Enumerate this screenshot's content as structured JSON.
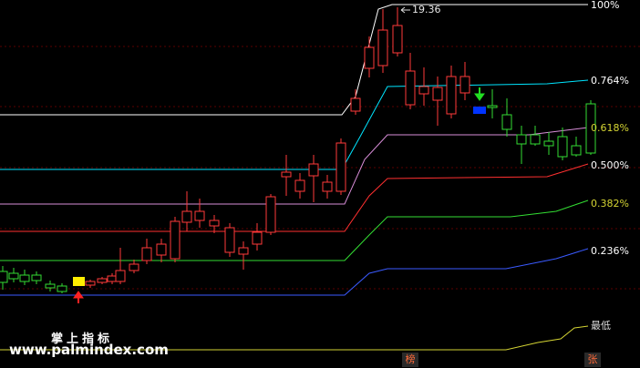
{
  "chart": {
    "high_label": "19.36",
    "levels": [
      {
        "label": "100%",
        "color": "#ffffff"
      },
      {
        "label": "0.764%",
        "color": "#00e5ff"
      },
      {
        "label": "0.618%",
        "color": "#d98ed9"
      },
      {
        "label": "0.500%",
        "color": "#ff3030"
      },
      {
        "label": "0.382%",
        "color": "#d4d433"
      },
      {
        "label": "0.236%",
        "color": "#3a5aff"
      },
      {
        "label": "最低",
        "color": "#dddddd"
      }
    ]
  },
  "watermark": {
    "title": "掌上指标",
    "url": "www.palmindex.com"
  },
  "footer_tags": [
    {
      "label": "榜",
      "color": "#ff6a3a"
    },
    {
      "label": "张",
      "color": "#ff6a3a"
    }
  ],
  "colors": {
    "up": "#ff3a3a",
    "down": "#33dd33",
    "neutral": "#ffffff",
    "buy_signal": "#ffee00",
    "sell_signal": "#0033ff"
  }
}
